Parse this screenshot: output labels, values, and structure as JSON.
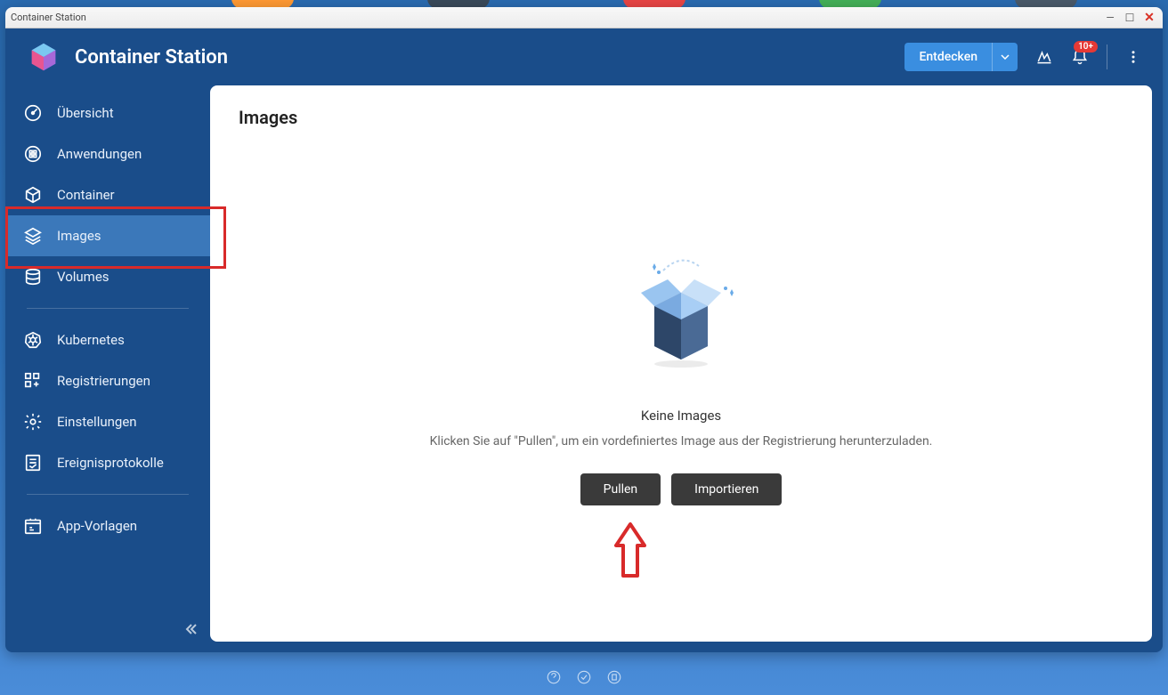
{
  "window": {
    "title": "Container Station"
  },
  "header": {
    "app_title": "Container Station",
    "discover_label": "Entdecken",
    "notification_badge": "10+"
  },
  "sidebar": {
    "items": [
      {
        "label": "Übersicht",
        "icon": "gauge"
      },
      {
        "label": "Anwendungen",
        "icon": "apps"
      },
      {
        "label": "Container",
        "icon": "cube"
      },
      {
        "label": "Images",
        "icon": "layers",
        "active": true
      },
      {
        "label": "Volumes",
        "icon": "database"
      }
    ],
    "items2": [
      {
        "label": "Kubernetes",
        "icon": "kubernetes"
      },
      {
        "label": "Registrierungen",
        "icon": "registry"
      },
      {
        "label": "Einstellungen",
        "icon": "gear"
      },
      {
        "label": "Ereignisprotokolle",
        "icon": "log"
      }
    ],
    "items3": [
      {
        "label": "App-Vorlagen",
        "icon": "template"
      }
    ]
  },
  "main": {
    "title": "Images",
    "empty_title": "Keine Images",
    "empty_desc": "Klicken Sie auf \"Pullen\", um ein vordefiniertes Image aus der Registrierung herunterzuladen.",
    "pull_label": "Pullen",
    "import_label": "Importieren"
  }
}
